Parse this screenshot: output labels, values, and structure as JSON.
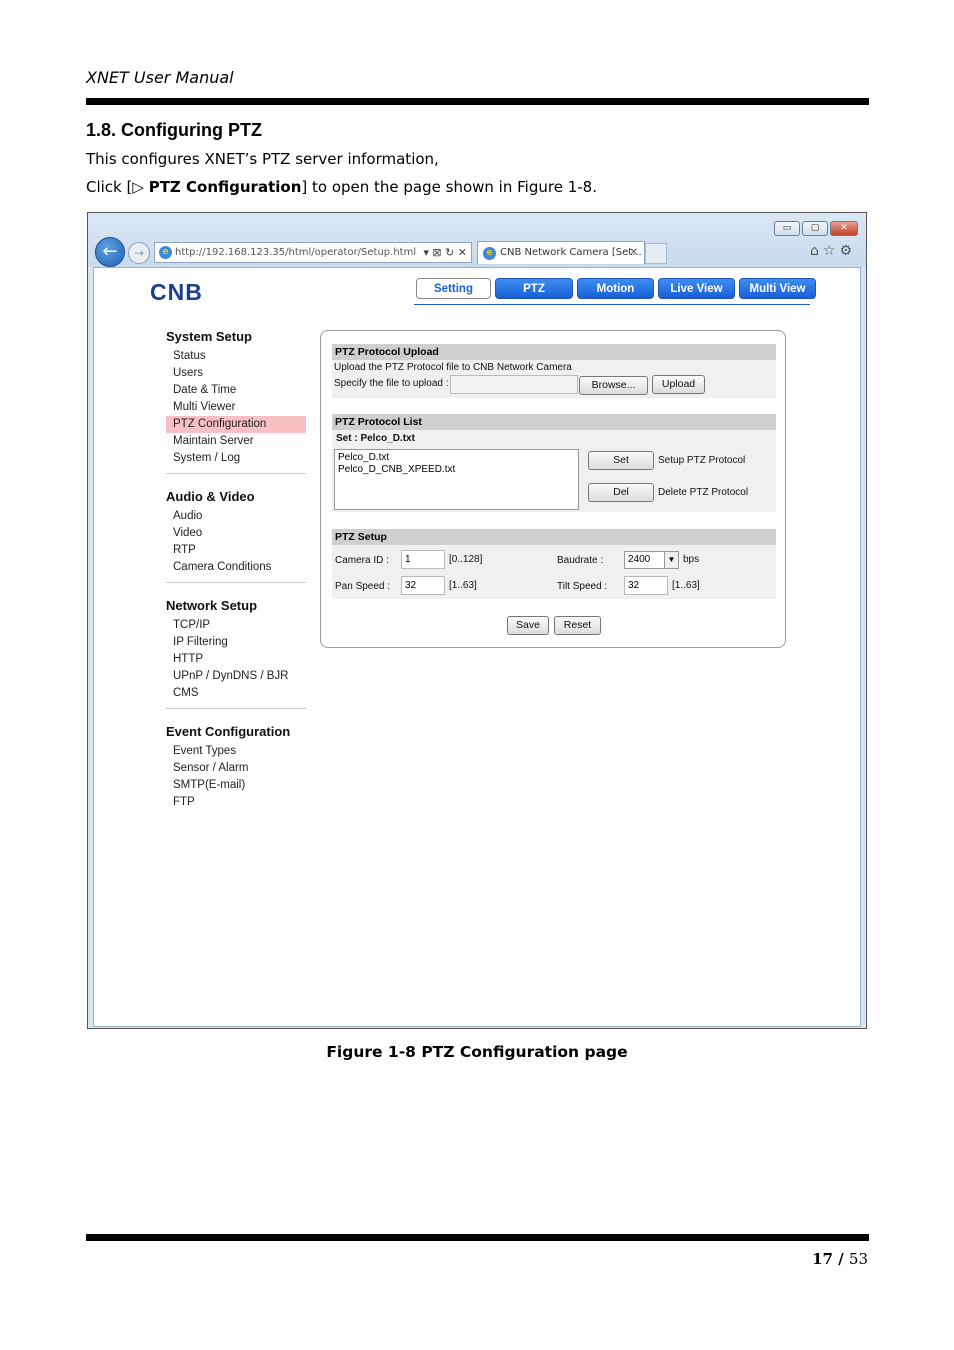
{
  "header": {
    "title": "XNET User Manual"
  },
  "section": {
    "title": "1.8. Configuring PTZ",
    "intro": "This configures XNET’s PTZ server information,",
    "click_prefix": "Click [",
    "click_arrow": "▷",
    "click_bold": "PTZ Configuration",
    "click_suffix": "] to open the page shown in Figure 1-8."
  },
  "browser": {
    "address": "http://192.168.123.35/html/operator/Setup.html",
    "address_controls": "▾ ⊠ ↻ ✕",
    "tab_title": "CNB Network Camera [Set...",
    "tab_close": "✕",
    "window_buttons": [
      "▭",
      "▢",
      "✕"
    ],
    "toolbar_icons": "⌂☆⚙"
  },
  "app": {
    "logo": "CNB",
    "nav": [
      "Setting",
      "PTZ",
      "Motion",
      "Live View",
      "Multi View"
    ],
    "sidebar": [
      {
        "title": "System Setup",
        "items": [
          "Status",
          "Users",
          "Date & Time",
          "Multi Viewer",
          "PTZ Configuration",
          "Maintain Server",
          "System / Log"
        ]
      },
      {
        "title": "Audio & Video",
        "items": [
          "Audio",
          "Video",
          "RTP",
          "Camera Conditions"
        ]
      },
      {
        "title": "Network Setup",
        "items": [
          "TCP/IP",
          "IP Filtering",
          "HTTP",
          "UPnP / DynDNS / BJR",
          "CMS"
        ]
      },
      {
        "title": "Event Configuration",
        "items": [
          "Event Types",
          "Sensor / Alarm",
          "SMTP(E-mail)",
          "FTP"
        ]
      }
    ],
    "selected_item": "PTZ Configuration",
    "upload": {
      "title": "PTZ Protocol Upload",
      "desc": "Upload the PTZ Protocol file to CNB Network Camera",
      "specify": "Specify the file to upload :",
      "file_value": "",
      "browse": "Browse...",
      "upload": "Upload"
    },
    "list": {
      "title": "PTZ Protocol List",
      "current": "Set : Pelco_D.txt",
      "files": [
        "Pelco_D.txt",
        "Pelco_D_CNB_XPEED.txt"
      ],
      "set_button": "Set",
      "set_desc": "Setup PTZ Protocol",
      "del_button": "Del",
      "del_desc": "Delete PTZ Protocol"
    },
    "setup": {
      "title": "PTZ Setup",
      "camera_id_label": "Camera ID :",
      "camera_id": "1",
      "camera_id_range": "[0..128]",
      "baudrate_label": "Baudrate :",
      "baudrate": "2400",
      "baudrate_unit": "bps",
      "pan_label": "Pan Speed :",
      "pan": "32",
      "pan_range": "[1..63]",
      "tilt_label": "Tilt Speed :",
      "tilt": "32",
      "tilt_range": "[1..63]"
    },
    "save": "Save",
    "reset": "Reset"
  },
  "caption": "Figure 1-8 PTZ Configuration page",
  "footer": {
    "page": "17",
    "sep": " / ",
    "total": "53"
  },
  "colors": {
    "nav_blue": "#1a5ed8",
    "selected": "#f8c0c4",
    "panel_header": "#cfcfcf"
  }
}
